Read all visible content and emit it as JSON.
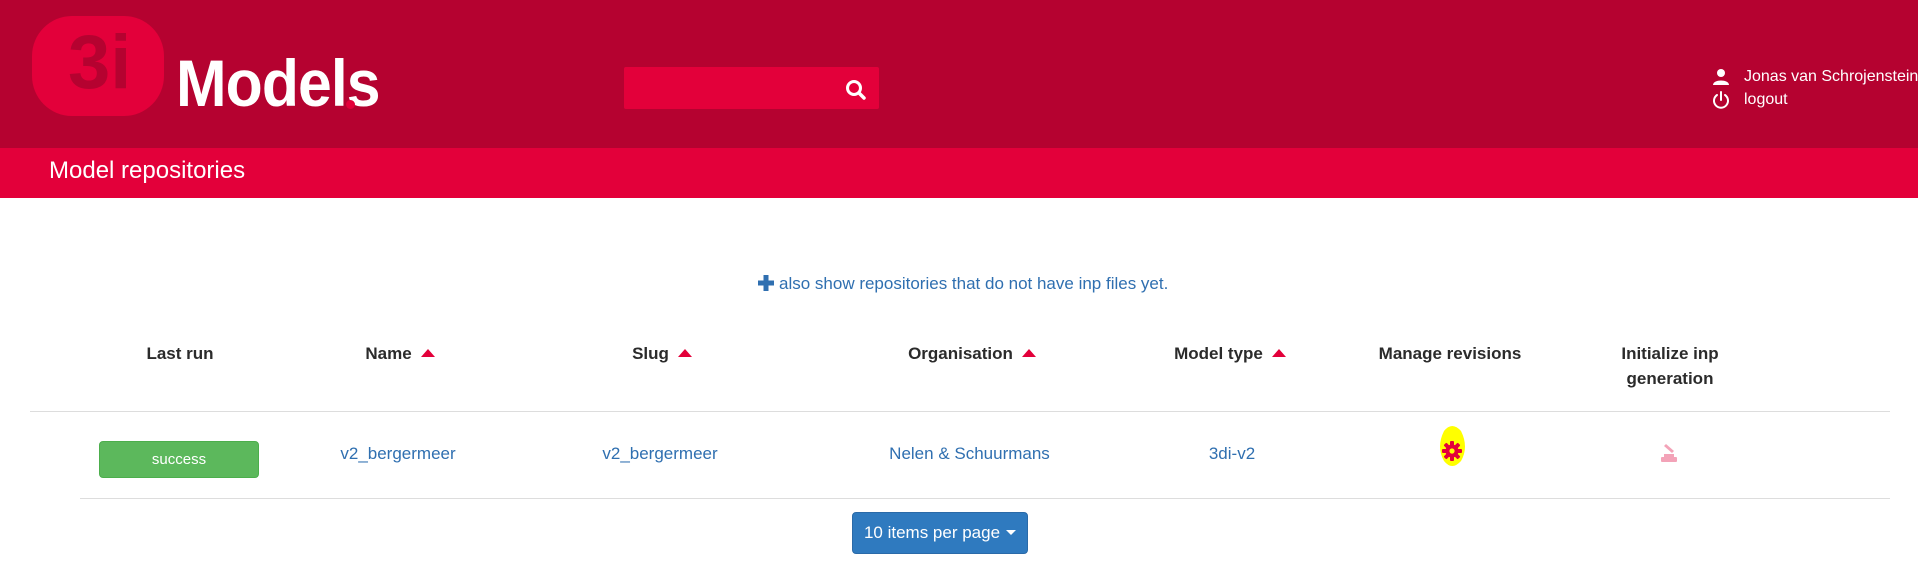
{
  "header": {
    "logo_text": "Models",
    "logo_mark_text": "3i",
    "search": {
      "placeholder": "",
      "value": ""
    },
    "search_icon": "search-icon",
    "user": {
      "name": "Jonas van Schrojenstein",
      "logout_label": "logout",
      "user_icon": "user-icon",
      "power_icon": "power-icon"
    }
  },
  "page": {
    "title": "Model repositories"
  },
  "toggle": {
    "label": "also show repositories that do not have inp files yet.",
    "icon": "plus-icon"
  },
  "table": {
    "columns": [
      {
        "label": "Last run",
        "sortable": false
      },
      {
        "label": "Name",
        "sortable": true
      },
      {
        "label": "Slug",
        "sortable": true
      },
      {
        "label": "Organisation",
        "sortable": true
      },
      {
        "label": "Model type",
        "sortable": true
      },
      {
        "label": "Manage revisions",
        "sortable": false
      },
      {
        "label": "Initialize inp",
        "label_line2": "generation",
        "sortable": false
      }
    ],
    "rows": [
      {
        "last_run": "success",
        "name": "v2_bergermeer",
        "slug": "v2_bergermeer",
        "organisation": "Nelen & Schuurmans",
        "model_type": "3di-v2",
        "manage_icon": "gear-icon",
        "init_icon": "init-inp-icon"
      }
    ]
  },
  "pagination": {
    "per_page_label": "10 items per page"
  },
  "colors": {
    "header_bg": "#b50230",
    "subheader_bg": "#e3003a",
    "link": "#2f6fb0",
    "success": "#5cb85c",
    "button_primary": "#2f7abf",
    "highlight": "#ffff00"
  }
}
